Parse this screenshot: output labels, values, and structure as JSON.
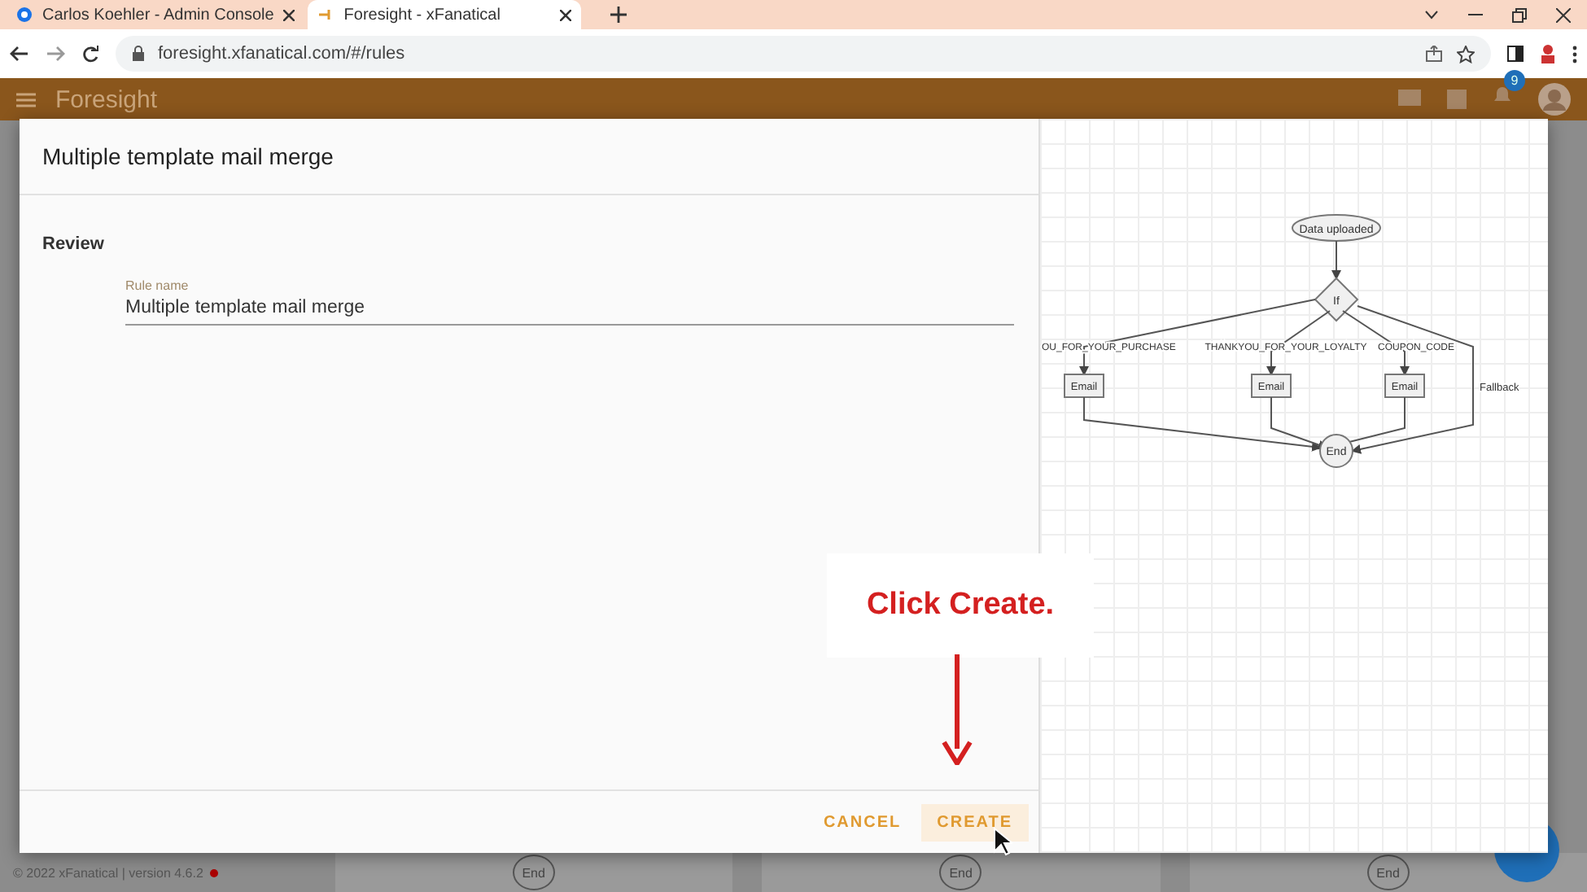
{
  "browser": {
    "tabs": [
      {
        "title": "Carlos Koehler - Admin Console",
        "selected": false
      },
      {
        "title": "Foresight - xFanatical",
        "selected": true
      }
    ],
    "address": "foresight.xfanatical.com/#/rules"
  },
  "app_bar": {
    "title": "Foresight",
    "notification_count": "9"
  },
  "dialog": {
    "title": "Multiple template mail merge",
    "section": "Review",
    "field": {
      "label": "Rule name",
      "value": "Multiple template mail merge"
    },
    "buttons": [
      {
        "label": "CANCEL",
        "hovered": false
      },
      {
        "label": "CREATE",
        "hovered": true
      }
    ],
    "diagram": {
      "start": "Data uploaded",
      "decision": "If",
      "end": "End",
      "branches": [
        {
          "label": "OU_FOR_YOUR_PURCHASE",
          "kind": "action",
          "action": "Email"
        },
        {
          "label": "THANKYOU_FOR_YOUR_LOYALTY",
          "kind": "action",
          "action": "Email"
        },
        {
          "label": "COUPON_CODE",
          "kind": "action",
          "action": "Email"
        },
        {
          "label": "Fallback",
          "kind": "direct"
        }
      ]
    }
  },
  "footer": {
    "text": "© 2022 xFanatical | version 4.6.2",
    "end_nodes": [
      "End",
      "End",
      "End"
    ]
  },
  "callout": {
    "text": "Click Create."
  }
}
